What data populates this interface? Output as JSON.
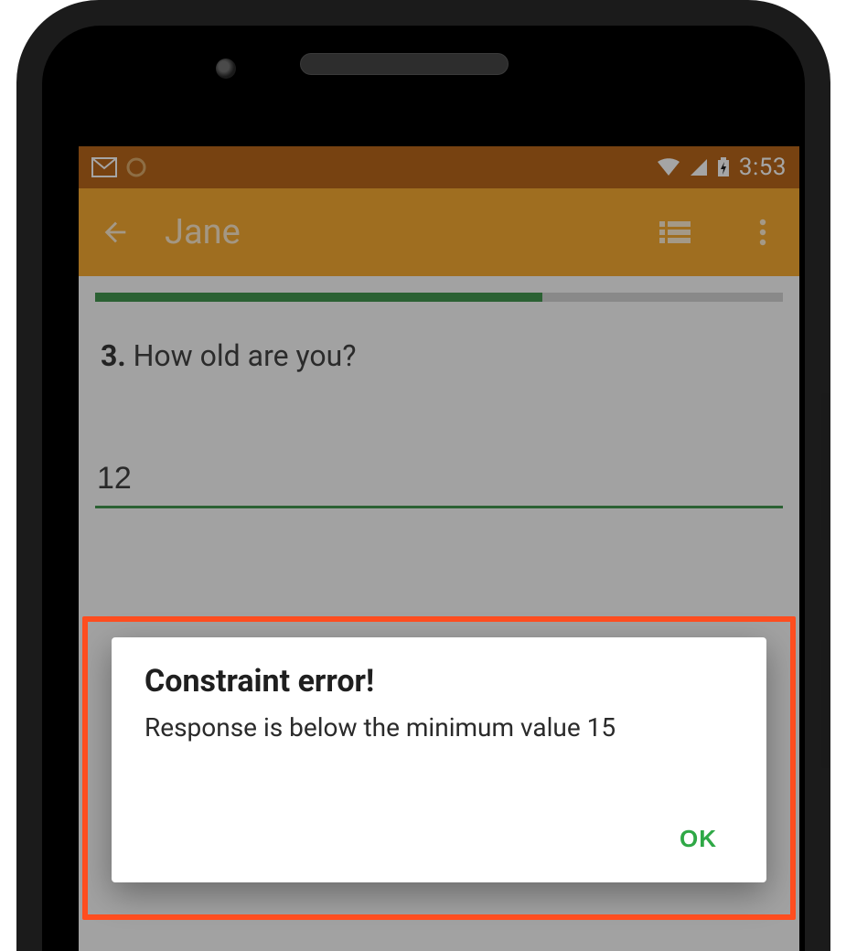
{
  "statusbar": {
    "clock": "3:53"
  },
  "appbar": {
    "title": "Jane"
  },
  "progress": {
    "percent": 65
  },
  "question": {
    "number": "3.",
    "text": "How old are you?"
  },
  "answer": {
    "value": "12"
  },
  "dialog": {
    "title": "Constraint error!",
    "message": "Response is below the minimum value 15",
    "ok_label": "OK"
  }
}
